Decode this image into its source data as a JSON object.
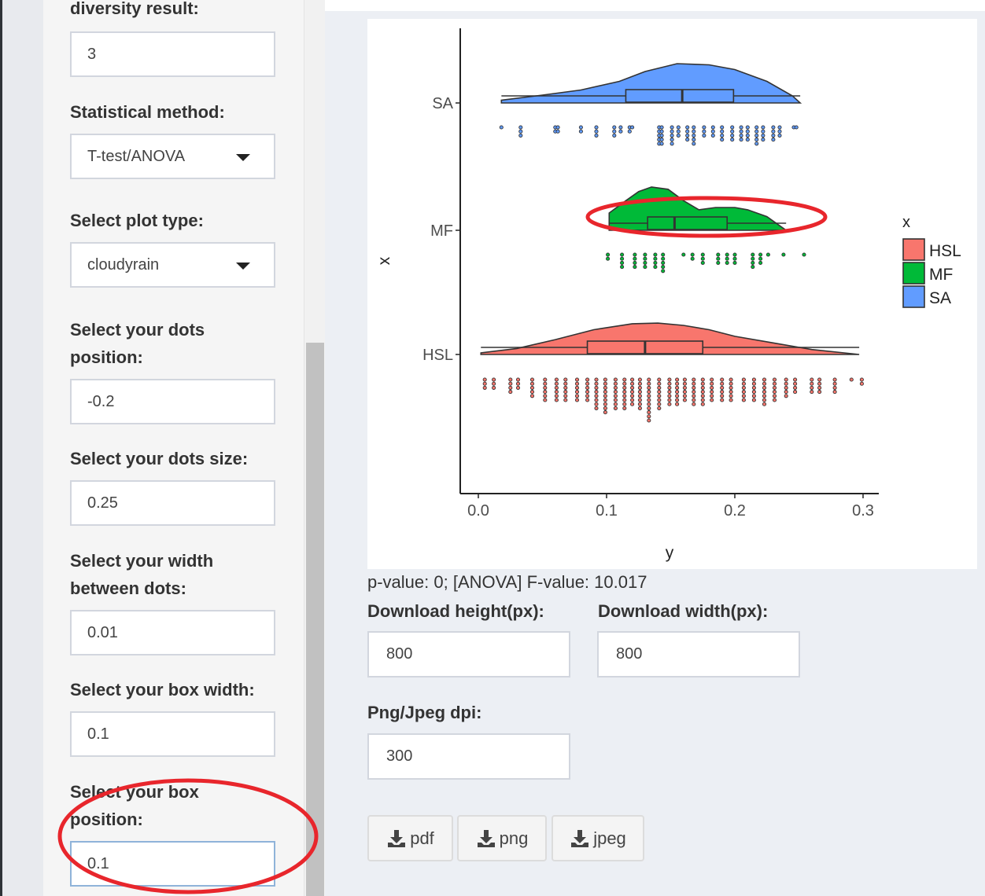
{
  "sidebar": {
    "top_label_partial": "diversity result:",
    "top_value": "3",
    "method_label": "Statistical method:",
    "method_value": "T-test/ANOVA",
    "plottype_label": "Select plot type:",
    "plottype_value": "cloudyrain",
    "dots_position_label_1": "Select your dots",
    "dots_position_label_2": "position:",
    "dots_position_value": "-0.2",
    "dots_size_label": "Select your dots size:",
    "dots_size_value": "0.25",
    "dots_width_label_1": "Select your width",
    "dots_width_label_2": "between dots:",
    "dots_width_value": "0.01",
    "box_width_label": "Select your box width:",
    "box_width_value": "0.1",
    "box_position_label_1": "Select your box",
    "box_position_label_2": "position:",
    "box_position_value": "0.1"
  },
  "main": {
    "pvalue_text": "p-value: 0; [ANOVA] F-value: 10.017",
    "download_height_label": "Download height(px):",
    "download_height_value": "800",
    "download_width_label": "Download width(px):",
    "download_width_value": "800",
    "dpi_label": "Png/Jpeg dpi:",
    "dpi_value": "300",
    "btn_pdf": "pdf",
    "btn_png": "png",
    "btn_jpeg": "jpeg",
    "icons": [
      "download-icon"
    ]
  },
  "annotation_color": "#e8262c",
  "chart_data": {
    "type": "raincloud",
    "xlabel": "y",
    "ylabel": "x",
    "legend_title": "x",
    "legend_position": "right",
    "x_ticks": [
      "0.0",
      "0.1",
      "0.2",
      "0.3"
    ],
    "xlim": [
      -0.015,
      0.315
    ],
    "grid": false,
    "categories": [
      "SA",
      "MF",
      "HSL"
    ],
    "series": [
      {
        "name": "SA",
        "color": "#619cff",
        "box": {
          "min": 0.018,
          "q1": 0.115,
          "median": 0.159,
          "q3": 0.199,
          "max": 0.251
        },
        "density": [
          [
            0.018,
            0.07
          ],
          [
            0.05,
            0.2
          ],
          [
            0.08,
            0.33
          ],
          [
            0.11,
            0.55
          ],
          [
            0.13,
            0.8
          ],
          [
            0.155,
            1.0
          ],
          [
            0.18,
            0.97
          ],
          [
            0.2,
            0.85
          ],
          [
            0.225,
            0.55
          ],
          [
            0.245,
            0.18
          ],
          [
            0.251,
            0.0
          ]
        ],
        "dots": [
          [
            0.018,
            1
          ],
          [
            0.033,
            3
          ],
          [
            0.06,
            2
          ],
          [
            0.062,
            2
          ],
          [
            0.08,
            2
          ],
          [
            0.092,
            3
          ],
          [
            0.106,
            3
          ],
          [
            0.111,
            2
          ],
          [
            0.118,
            2
          ],
          [
            0.12,
            1
          ],
          [
            0.141,
            5
          ],
          [
            0.143,
            5
          ],
          [
            0.151,
            5
          ],
          [
            0.156,
            3
          ],
          [
            0.163,
            4
          ],
          [
            0.168,
            5
          ],
          [
            0.176,
            3
          ],
          [
            0.183,
            3
          ],
          [
            0.19,
            4
          ],
          [
            0.198,
            4
          ],
          [
            0.205,
            4
          ],
          [
            0.21,
            4
          ],
          [
            0.217,
            5
          ],
          [
            0.222,
            4
          ],
          [
            0.23,
            4
          ],
          [
            0.235,
            3
          ],
          [
            0.246,
            1
          ],
          [
            0.248,
            1
          ]
        ]
      },
      {
        "name": "MF",
        "color": "#00ba38",
        "box": {
          "min": 0.102,
          "q1": 0.132,
          "median": 0.153,
          "q3": 0.194,
          "max": 0.24
        },
        "density": [
          [
            0.102,
            0.38
          ],
          [
            0.115,
            0.65
          ],
          [
            0.125,
            0.85
          ],
          [
            0.135,
            0.95
          ],
          [
            0.148,
            0.9
          ],
          [
            0.16,
            0.65
          ],
          [
            0.172,
            0.45
          ],
          [
            0.185,
            0.5
          ],
          [
            0.2,
            0.5
          ],
          [
            0.21,
            0.45
          ],
          [
            0.225,
            0.3
          ],
          [
            0.24,
            0.0
          ]
        ],
        "dots": [
          [
            0.101,
            2
          ],
          [
            0.112,
            4
          ],
          [
            0.122,
            4
          ],
          [
            0.13,
            4
          ],
          [
            0.138,
            4
          ],
          [
            0.144,
            5
          ],
          [
            0.16,
            1
          ],
          [
            0.167,
            2
          ],
          [
            0.175,
            3
          ],
          [
            0.187,
            3
          ],
          [
            0.194,
            3
          ],
          [
            0.2,
            3
          ],
          [
            0.214,
            4
          ],
          [
            0.22,
            3
          ],
          [
            0.226,
            1
          ],
          [
            0.238,
            1
          ],
          [
            0.254,
            1
          ]
        ]
      },
      {
        "name": "HSL",
        "color": "#f8766d",
        "box": {
          "min": 0.002,
          "q1": 0.085,
          "median": 0.13,
          "q3": 0.175,
          "max": 0.297
        },
        "density": [
          [
            0.002,
            0.05
          ],
          [
            0.03,
            0.18
          ],
          [
            0.06,
            0.45
          ],
          [
            0.09,
            0.75
          ],
          [
            0.12,
            0.93
          ],
          [
            0.14,
            0.95
          ],
          [
            0.16,
            0.88
          ],
          [
            0.18,
            0.75
          ],
          [
            0.2,
            0.55
          ],
          [
            0.23,
            0.35
          ],
          [
            0.26,
            0.15
          ],
          [
            0.297,
            0.0
          ]
        ],
        "dots": [
          [
            0.005,
            3
          ],
          [
            0.012,
            3
          ],
          [
            0.025,
            4
          ],
          [
            0.031,
            3
          ],
          [
            0.042,
            5
          ],
          [
            0.052,
            6
          ],
          [
            0.061,
            6
          ],
          [
            0.068,
            6
          ],
          [
            0.077,
            6
          ],
          [
            0.085,
            6
          ],
          [
            0.092,
            8
          ],
          [
            0.099,
            9
          ],
          [
            0.107,
            8
          ],
          [
            0.114,
            8
          ],
          [
            0.12,
            7
          ],
          [
            0.126,
            8
          ],
          [
            0.133,
            11
          ],
          [
            0.141,
            8
          ],
          [
            0.149,
            7
          ],
          [
            0.155,
            7
          ],
          [
            0.161,
            6
          ],
          [
            0.168,
            7
          ],
          [
            0.175,
            7
          ],
          [
            0.182,
            6
          ],
          [
            0.19,
            6
          ],
          [
            0.197,
            6
          ],
          [
            0.207,
            6
          ],
          [
            0.215,
            6
          ],
          [
            0.223,
            7
          ],
          [
            0.231,
            6
          ],
          [
            0.24,
            5
          ],
          [
            0.247,
            4
          ],
          [
            0.26,
            4
          ],
          [
            0.266,
            4
          ],
          [
            0.278,
            4
          ],
          [
            0.291,
            1
          ],
          [
            0.299,
            2
          ]
        ]
      }
    ]
  }
}
